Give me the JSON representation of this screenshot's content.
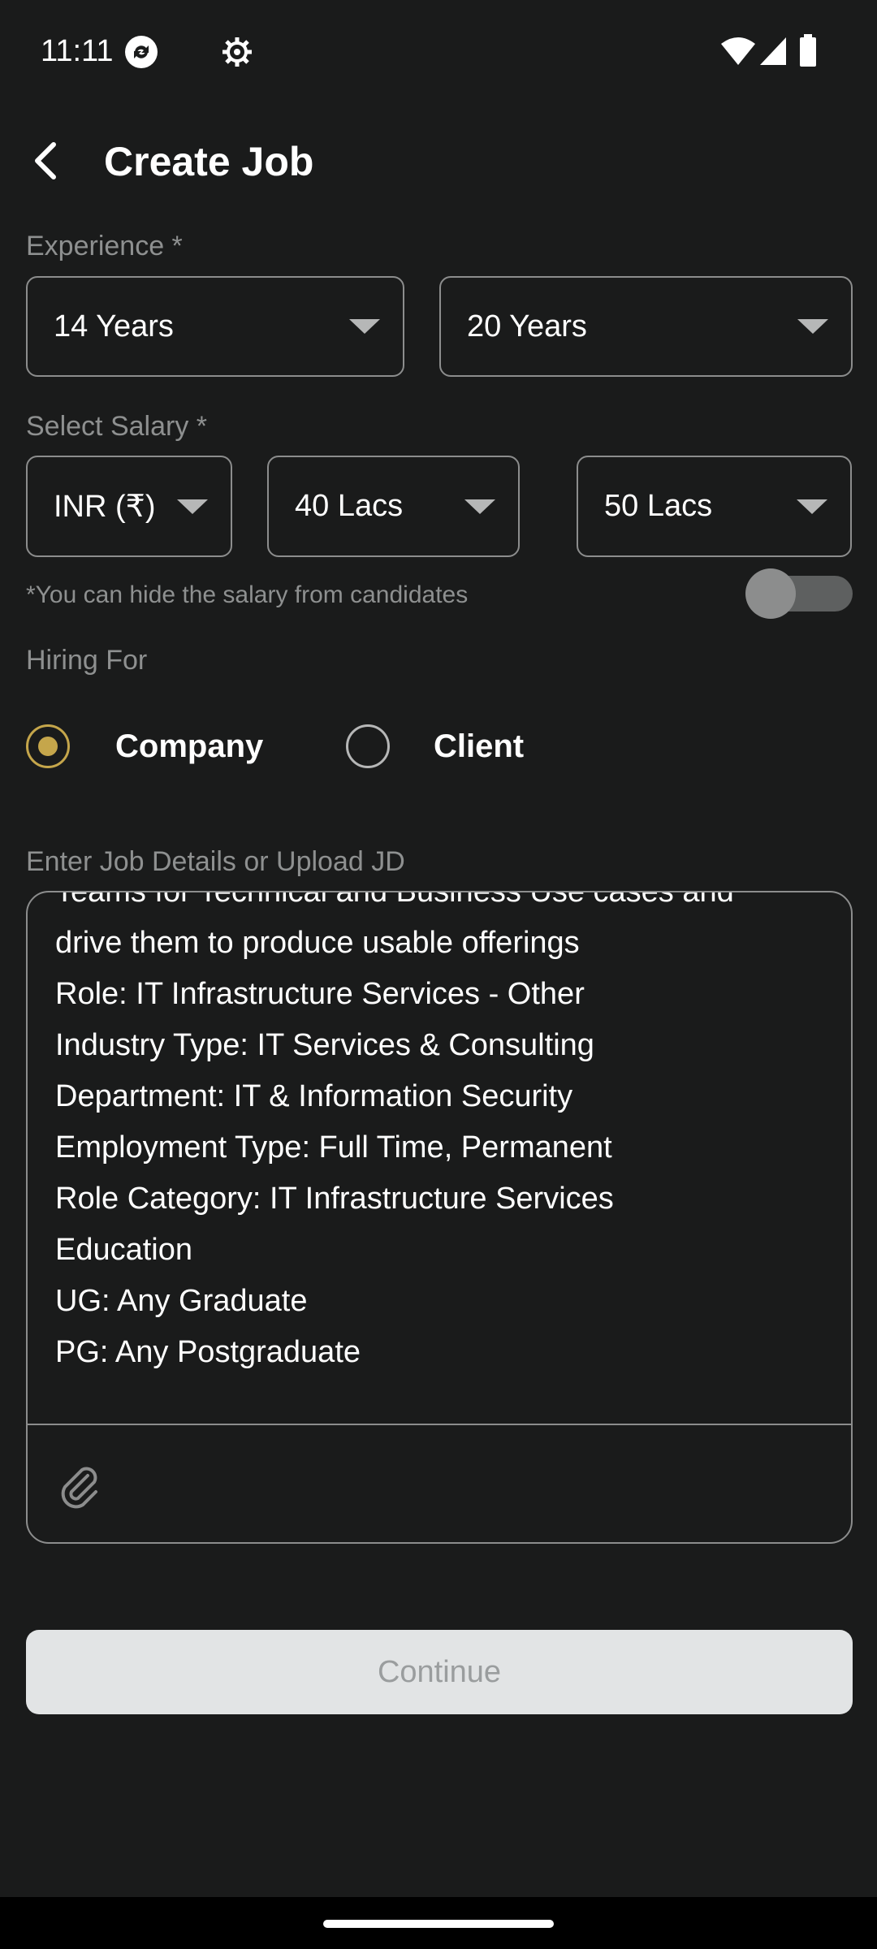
{
  "status_bar": {
    "time": "11:11",
    "icons": [
      "sync-icon",
      "settings-gear-icon",
      "wifi-icon",
      "signal-icon",
      "battery-icon"
    ]
  },
  "header": {
    "back_icon": "arrow-back-icon",
    "title": "Create Job"
  },
  "experience": {
    "label": "Experience *",
    "min_value": "14 Years",
    "max_value": "20 Years"
  },
  "salary": {
    "label": "Select Salary *",
    "currency": "INR (₹)",
    "min_value": "40 Lacs",
    "max_value": "50 Lacs",
    "hide_hint": "*You can hide the salary from candidates",
    "hide_toggle_on": false
  },
  "hiring_for": {
    "label": "Hiring For",
    "options": [
      {
        "label": "Company",
        "selected": true
      },
      {
        "label": "Client",
        "selected": false
      }
    ]
  },
  "job_details": {
    "label": "Enter Job Details or Upload JD",
    "lines": [
      "Teams for Technical and Business Use cases and",
      "drive them to produce usable offerings",
      "Role: IT Infrastructure Services - Other",
      "Industry Type: IT Services & Consulting",
      "Department: IT & Information Security",
      "Employment Type: Full Time, Permanent",
      "Role Category: IT Infrastructure Services",
      "Education",
      "UG: Any Graduate",
      "PG: Any Postgraduate"
    ],
    "attach_icon": "paperclip-icon"
  },
  "continue_label": "Continue",
  "colors": {
    "background": "#1a1b1b",
    "accent": "#c5a64b",
    "border": "#8c8d8d",
    "button_disabled_bg": "#e2e4e5"
  }
}
